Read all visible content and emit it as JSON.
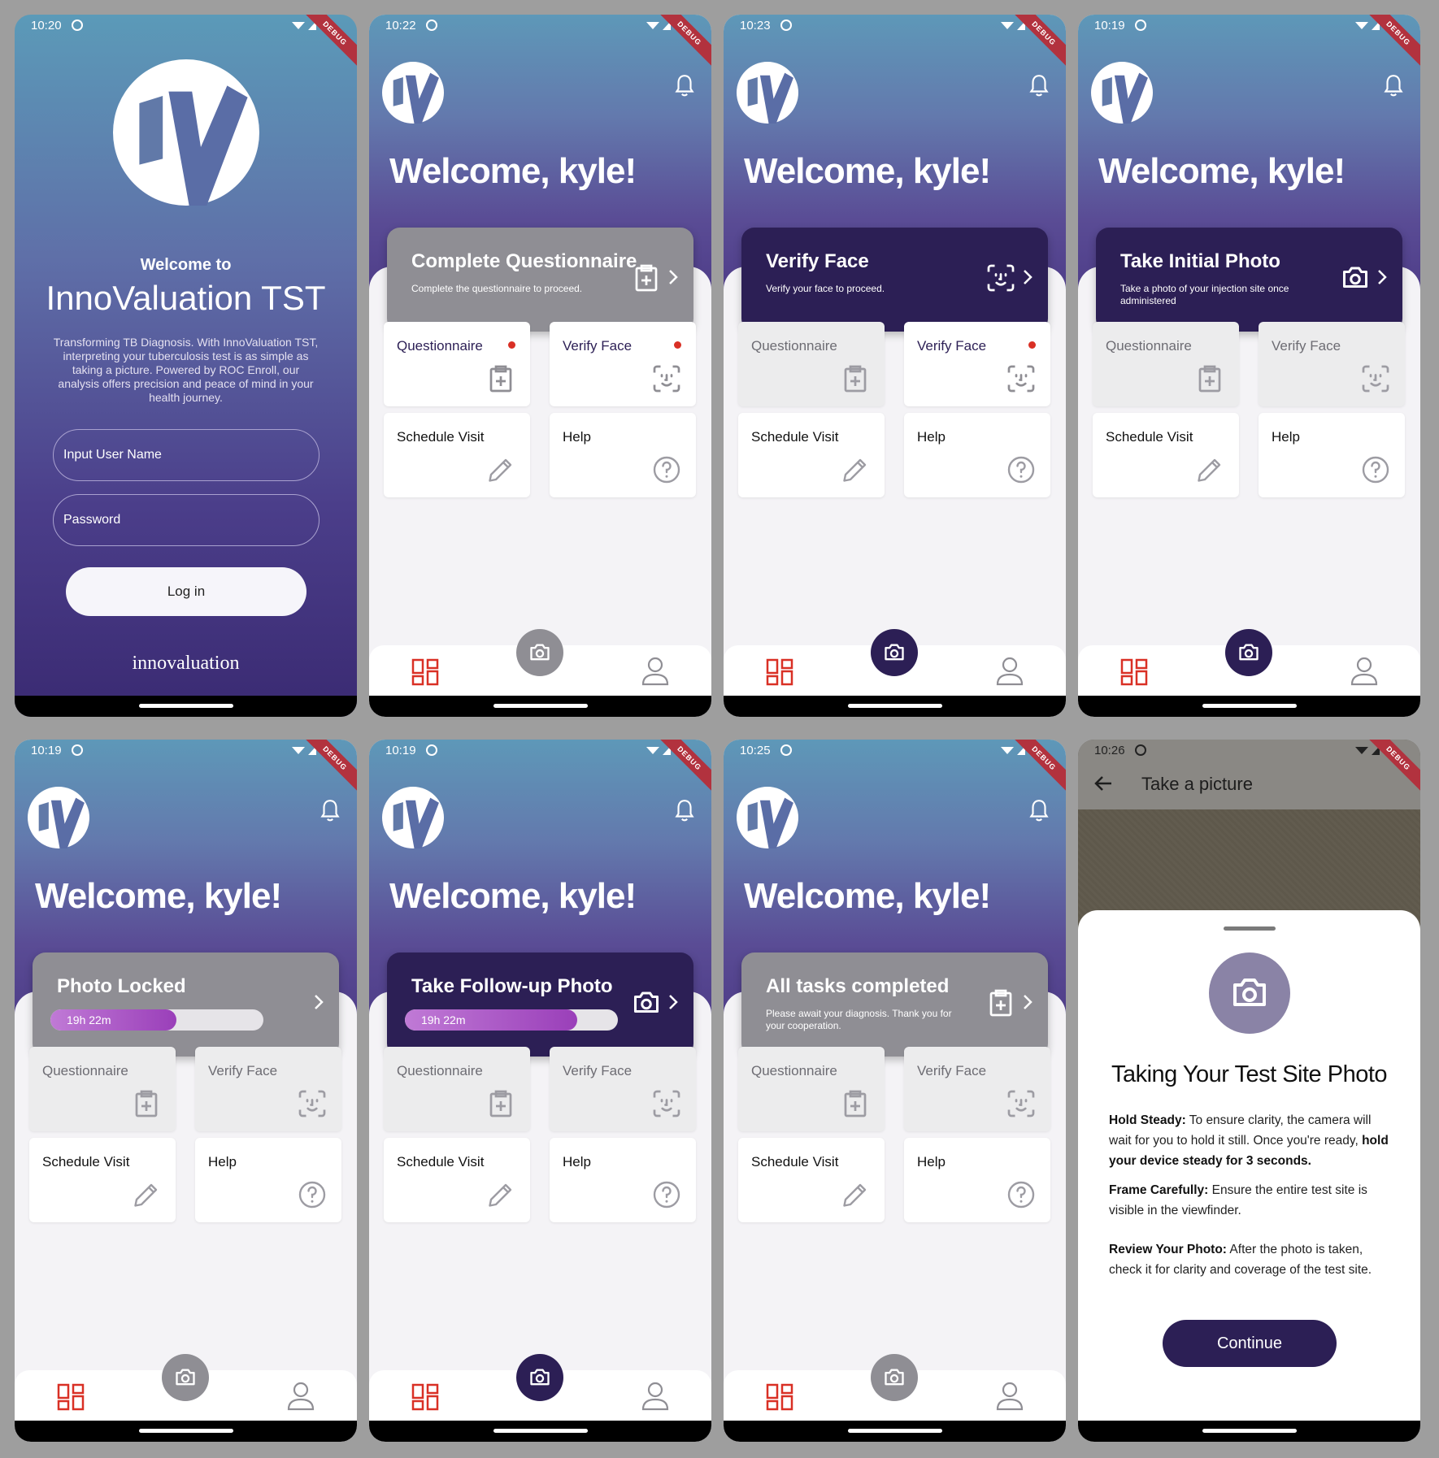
{
  "login": {
    "time": "10:20",
    "welcome_to": "Welcome to",
    "app_name": "InnoValuation TST",
    "description": "Transforming TB Diagnosis. With InnoValuation TST, interpreting your tuberculosis test is as simple as taking a picture. Powered by ROC Enroll, our analysis offers precision and peace of mind in your health journey.",
    "username_placeholder": "Input User Name",
    "password_placeholder": "Password",
    "login_label": "Log in",
    "brand": "innovaluation"
  },
  "debug_label": "DEBUG",
  "welcome_text": "Welcome, kyle!",
  "tiles": {
    "questionnaire": "Questionnaire",
    "verify_face": "Verify Face",
    "schedule_visit": "Schedule Visit",
    "help": "Help"
  },
  "screens": [
    {
      "time": "10:22",
      "hero_title": "Complete Questionnaire",
      "hero_sub": "Complete the questionnaire to proceed."
    },
    {
      "time": "10:23",
      "hero_title": "Verify Face",
      "hero_sub": "Verify your face to proceed."
    },
    {
      "time": "10:19",
      "hero_title": "Take Initial Photo",
      "hero_sub": "Take a photo of your injection site once administered"
    },
    {
      "time": "10:19",
      "hero_title": "Photo Locked",
      "progress_label": "19h 22m",
      "progress": 0.59
    },
    {
      "time": "10:19",
      "hero_title": "Take Follow-up Photo",
      "progress_label": "19h 22m",
      "progress": 0.81
    },
    {
      "time": "10:25",
      "hero_title": "All tasks completed",
      "hero_sub": "Please await your diagnosis. Thank you for your cooperation."
    }
  ],
  "camera": {
    "time": "10:26",
    "title": "Take a picture",
    "sheet_title": "Taking Your Test Site Photo",
    "p1_bold": "Hold Steady:",
    "p1_text": " To ensure clarity, the camera will wait for you to hold it still. Once you're ready, ",
    "p1_bold2": "hold your device steady for 3 seconds.",
    "p2_bold": "Frame Carefully:",
    "p2_text": " Ensure the entire test site is visible in the viewfinder.",
    "p3_bold": "Review Your Photo:",
    "p3_text": " After the photo is taken, check it for clarity and coverage of the test site.",
    "continue_label": "Continue"
  },
  "colors": {
    "primary": "#2c1f55",
    "disabled": "#8f8e94",
    "accent_red": "#d93025",
    "progress_fill": "#9a3fb9"
  },
  "icons": [
    "camera-icon",
    "clipboard-plus-icon",
    "face-id-icon",
    "pencil-icon",
    "help-circle-icon",
    "bell-icon",
    "dashboard-icon",
    "user-icon",
    "chevron-right-icon",
    "back-arrow-icon"
  ]
}
